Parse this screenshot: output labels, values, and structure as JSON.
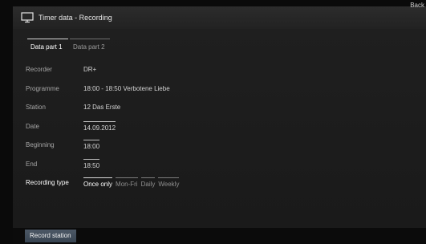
{
  "header": {
    "title": "Timer data - Recording",
    "back_label": "Back",
    "icon": "tv-icon"
  },
  "tabs": [
    {
      "label": "Data part 1",
      "active": true
    },
    {
      "label": "Data part 2",
      "active": false
    }
  ],
  "fields": {
    "recorder": {
      "label": "Recorder",
      "value": "DR+"
    },
    "programme": {
      "label": "Programme",
      "value": "18:00 - 18:50 Verbotene Liebe"
    },
    "station": {
      "label": "Station",
      "value": "12 Das Erste"
    },
    "date": {
      "label": "Date",
      "value": "14.09.2012"
    },
    "beginning": {
      "label": "Beginning",
      "value": "18:00"
    },
    "end": {
      "label": "End",
      "value": "18:50"
    }
  },
  "recording_type": {
    "label": "Recording type",
    "options": [
      "Once only",
      "Mon-Fri",
      "Daily",
      "Weekly"
    ],
    "selected": "Once only"
  },
  "footer": {
    "record_station_label": "Record station"
  }
}
